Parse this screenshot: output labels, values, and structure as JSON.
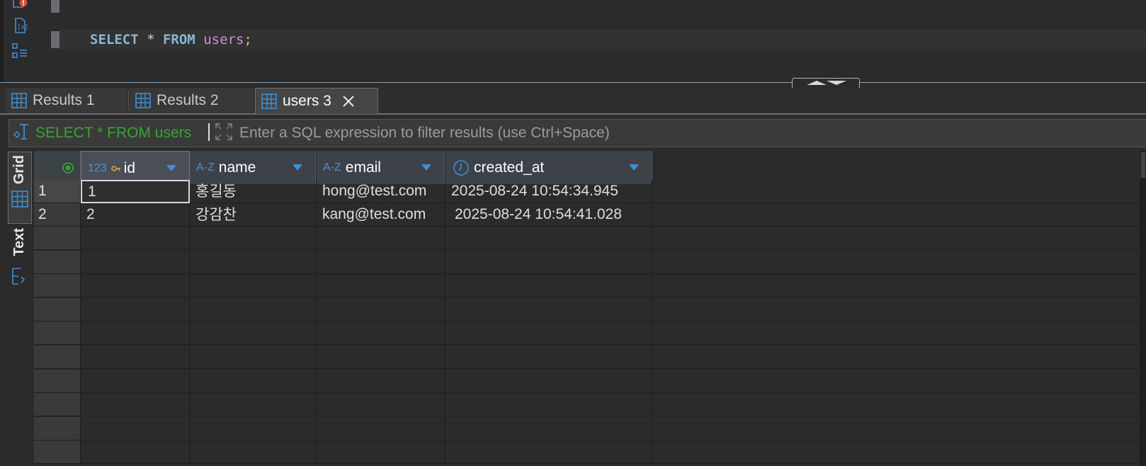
{
  "editor": {
    "sql": {
      "k1": "SELECT",
      "star": " * ",
      "k2": "FROM",
      "space": " ",
      "table": "users",
      "semi": ";"
    }
  },
  "tabs": [
    {
      "label": "Results 1",
      "icon": "grid-icon"
    },
    {
      "label": "Results 2",
      "icon": "grid-icon"
    },
    {
      "label": "users 3",
      "icon": "grid-icon",
      "active": true
    }
  ],
  "filter": {
    "query": "SELECT * FROM users",
    "placeholder": "Enter a SQL expression to filter results (use Ctrl+Space)"
  },
  "side_tabs": {
    "grid": "Grid",
    "text": "Text"
  },
  "table": {
    "columns": [
      {
        "type": "123",
        "name": "id",
        "key": true
      },
      {
        "type": "A-Z",
        "name": "name"
      },
      {
        "type": "A-Z",
        "name": "email"
      },
      {
        "type": "clock",
        "name": "created_at"
      }
    ],
    "rows": [
      {
        "num": "1",
        "id": "1",
        "name": "홍길동",
        "email": "hong@test.com",
        "created_at": "2025-08-24 10:54:34.945"
      },
      {
        "num": "2",
        "id": "2",
        "name": "강감찬",
        "email": "kang@test.com",
        "created_at": "2025-08-24 10:54:41.028"
      }
    ]
  },
  "colors": {
    "accent": "#3d8fd6",
    "filter_green": "#3aa335",
    "keyword": "#8ab6d6",
    "table_name": "#c893d8"
  }
}
